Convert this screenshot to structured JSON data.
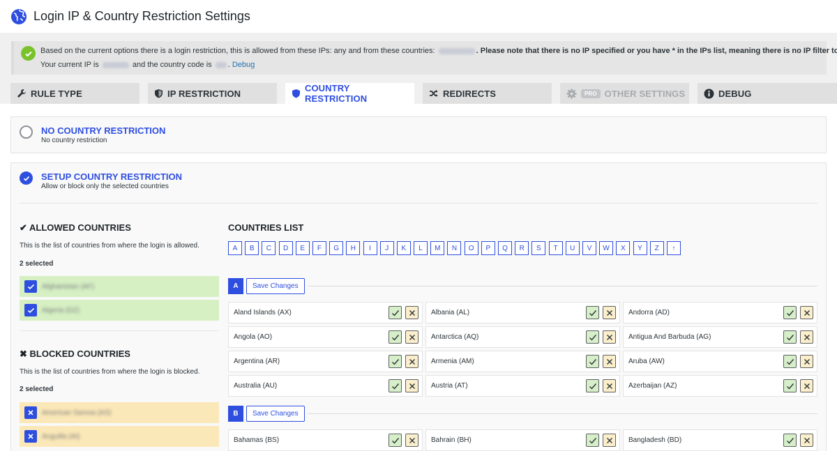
{
  "header": {
    "title": "Login IP & Country Restriction Settings"
  },
  "notice": {
    "line1_before": "Based on the current options there is a login restriction, this is allowed from these IPs: any and from these countries:",
    "line1_note": ". Please note that there is no IP specified or you have * in the IPs list, meaning there is no IP filter to apply.",
    "line2_prefix": "Your current IP is",
    "line2_mid": "and the country code is",
    "debug_link": "Debug"
  },
  "tabs": [
    {
      "label": "RULE TYPE",
      "icon": "wrench-icon"
    },
    {
      "label": "IP RESTRICTION",
      "icon": "shield-icon"
    },
    {
      "label": "COUNTRY RESTRICTION",
      "icon": "shield-icon"
    },
    {
      "label": "REDIRECTS",
      "icon": "shuffle-icon"
    },
    {
      "label": "OTHER SETTINGS",
      "icon": "gear-icon",
      "badge": "PRO"
    },
    {
      "label": "DEBUG",
      "icon": "info-icon"
    }
  ],
  "options": {
    "none": {
      "title": "NO COUNTRY RESTRICTION",
      "subtitle": "No country restriction"
    },
    "setup": {
      "title": "SETUP COUNTRY RESTRICTION",
      "subtitle": "Allow or block only the selected countries"
    }
  },
  "allowed": {
    "heading": "✔ ALLOWED COUNTRIES",
    "desc": "This is the list of countries from where the login is allowed.",
    "count": "2 selected",
    "items": [
      "Afghanistan (AF)",
      "Algeria (DZ)"
    ]
  },
  "blocked": {
    "heading": "✖ BLOCKED COUNTRIES",
    "desc": "This is the list of countries from where the login is blocked.",
    "count": "2 selected",
    "items": [
      "American Samoa (AS)",
      "Anguilla (AI)"
    ]
  },
  "countries_list": {
    "heading": "COUNTRIES LIST",
    "letters": [
      "A",
      "B",
      "C",
      "D",
      "E",
      "F",
      "G",
      "H",
      "I",
      "J",
      "K",
      "L",
      "M",
      "N",
      "O",
      "P",
      "Q",
      "R",
      "S",
      "T",
      "U",
      "V",
      "W",
      "X",
      "Y",
      "Z",
      "↑"
    ],
    "save_label": "Save Changes",
    "groups": [
      {
        "letter": "A",
        "countries": [
          "Aland Islands (AX)",
          "Albania (AL)",
          "Andorra (AD)",
          "Angola (AO)",
          "Antarctica (AQ)",
          "Antigua And Barbuda (AG)",
          "Argentina (AR)",
          "Armenia (AM)",
          "Aruba (AW)",
          "Australia (AU)",
          "Austria (AT)",
          "Azerbaijan (AZ)"
        ]
      },
      {
        "letter": "B",
        "countries": [
          "Bahamas (BS)",
          "Bahrain (BH)",
          "Bangladesh (BD)"
        ]
      }
    ]
  }
}
